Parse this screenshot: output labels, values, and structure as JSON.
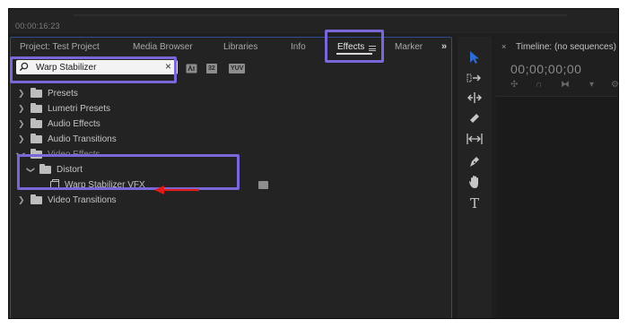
{
  "app": {
    "timecode": "00:00:16:23"
  },
  "effects_panel": {
    "tabs": [
      {
        "label": "Project: Test Project",
        "active": false
      },
      {
        "label": "Media Browser",
        "active": false
      },
      {
        "label": "Libraries",
        "active": false
      },
      {
        "label": "Info",
        "active": false
      },
      {
        "label": "Effects",
        "active": true
      },
      {
        "label": "Marker",
        "active": false
      }
    ],
    "overflow_label": "»",
    "search": {
      "value": "Warp Stabilizer",
      "placeholder": ""
    },
    "filter_badges": [
      "32",
      "YUV"
    ],
    "tree": [
      {
        "label": "Presets",
        "expanded": false
      },
      {
        "label": "Lumetri Presets",
        "expanded": false
      },
      {
        "label": "Audio Effects",
        "expanded": false
      },
      {
        "label": "Audio Transitions",
        "expanded": false
      },
      {
        "label": "Video Effects",
        "expanded": true
      },
      {
        "label": "Distort",
        "expanded": true
      },
      {
        "label": "Warp Stabilizer VFX",
        "expanded": false
      },
      {
        "label": "Video Transitions",
        "expanded": false
      }
    ]
  },
  "tools": [
    {
      "name": "selection-tool",
      "icon": "arrow-pointer-icon"
    },
    {
      "name": "track-select-tool",
      "icon": "track-select-icon"
    },
    {
      "name": "ripple-edit-tool",
      "icon": "ripple-edit-icon"
    },
    {
      "name": "razor-tool",
      "icon": "razor-icon"
    },
    {
      "name": "slip-tool",
      "icon": "slip-icon"
    },
    {
      "name": "pen-tool",
      "icon": "pen-icon"
    },
    {
      "name": "hand-tool",
      "icon": "hand-icon"
    },
    {
      "name": "type-tool",
      "icon": "type-icon",
      "label": "T"
    }
  ],
  "timeline": {
    "title": "Timeline: (no sequences)",
    "close_label": "×",
    "timecode": "00;00;00;00"
  },
  "colors": {
    "highlight": "#7b68d8",
    "arrow": "#e01b1b",
    "accent": "#2f6bd4"
  }
}
